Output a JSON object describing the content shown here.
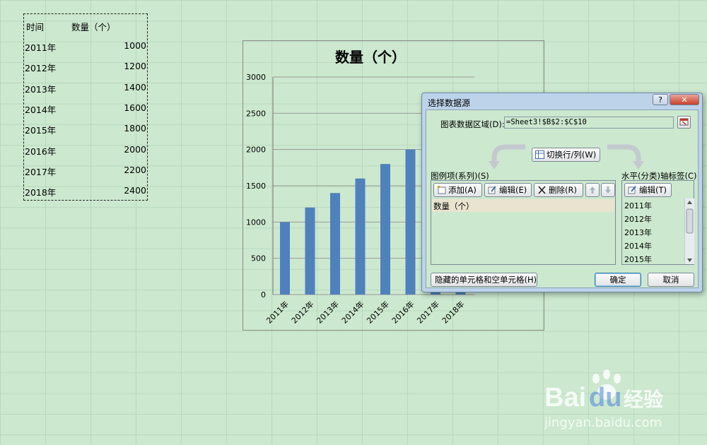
{
  "sheet": {
    "header_time": "时间",
    "header_count": "数量（个）",
    "rows": [
      {
        "year": "2011年",
        "count": "1000"
      },
      {
        "year": "2012年",
        "count": "1200"
      },
      {
        "year": "2013年",
        "count": "1400"
      },
      {
        "year": "2014年",
        "count": "1600"
      },
      {
        "year": "2015年",
        "count": "1800"
      },
      {
        "year": "2016年",
        "count": "2000"
      },
      {
        "year": "2017年",
        "count": "2200"
      },
      {
        "year": "2018年",
        "count": "2400"
      }
    ]
  },
  "chart_data": {
    "type": "bar",
    "title": "数量（个）",
    "categories": [
      "2011年",
      "2012年",
      "2013年",
      "2014年",
      "2015年",
      "2016年",
      "2017年",
      "2018年"
    ],
    "values": [
      1000,
      1200,
      1400,
      1600,
      1800,
      2000,
      2200,
      2400
    ],
    "ylim": [
      0,
      3000
    ],
    "yticks": [
      "0",
      "500",
      "1000",
      "1500",
      "2000",
      "2500",
      "3000"
    ],
    "grid": true,
    "bar_color": "#4f81bd"
  },
  "dialog": {
    "title": "选择数据源",
    "help_label": "?",
    "close_label": "✕",
    "range_label": "图表数据区域(D):",
    "range_value": "=Sheet3!$B$2:$C$10",
    "switch_label": "切换行/列(W)",
    "legend_label": "图例项(系列)(S)",
    "add_label": "添加(A)",
    "edit_label": "编辑(E)",
    "delete_label": "删除(R)",
    "series": [
      "数量（个）"
    ],
    "axis_label": "水平(分类)轴标签(C)",
    "axis_edit_label": "编辑(T)",
    "categories": [
      "2011年",
      "2012年",
      "2013年",
      "2014年",
      "2015年"
    ],
    "hidden_label": "隐藏的单元格和空单元格(H)",
    "ok_label": "确定",
    "cancel_label": "取消"
  },
  "watermark": {
    "brand": "Bai",
    "brand2": "du",
    "product": "经验",
    "url": "jingyan.baidu.com"
  }
}
